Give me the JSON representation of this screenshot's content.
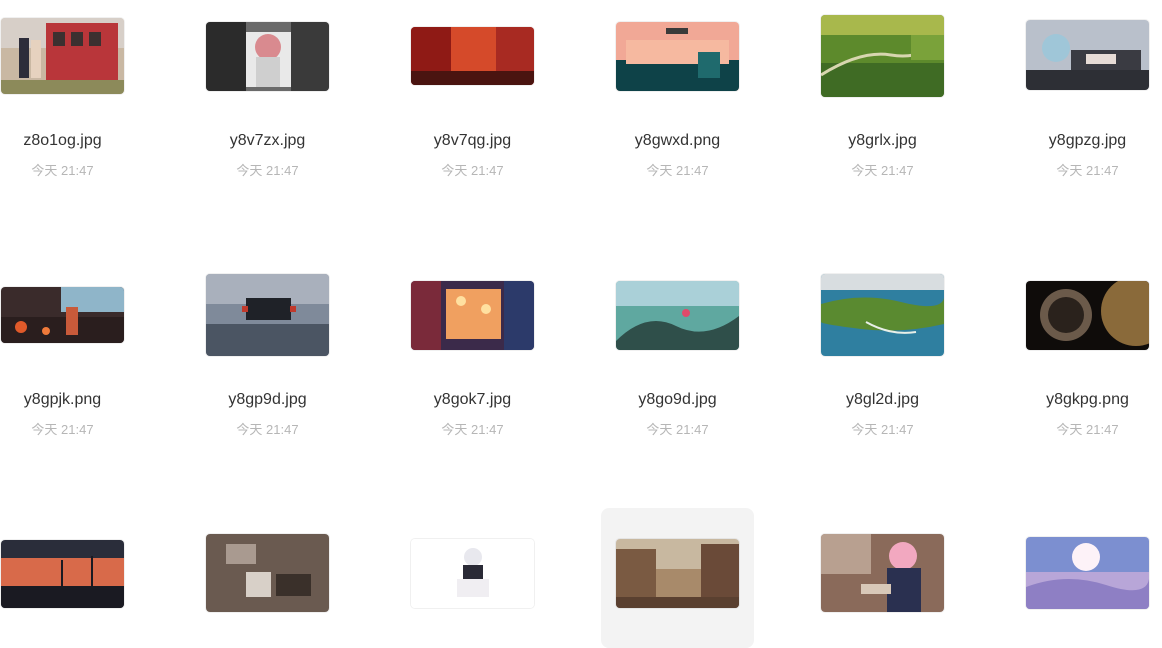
{
  "files": [
    {
      "name": "z8o1og.jpg",
      "date": "今天 21:47"
    },
    {
      "name": "y8v7zx.jpg",
      "date": "今天 21:47"
    },
    {
      "name": "y8v7qg.jpg",
      "date": "今天 21:47"
    },
    {
      "name": "y8gwxd.png",
      "date": "今天 21:47"
    },
    {
      "name": "y8grlx.jpg",
      "date": "今天 21:47"
    },
    {
      "name": "y8gpzg.jpg",
      "date": "今天 21:47"
    },
    {
      "name": "y8gpjk.png",
      "date": "今天 21:47"
    },
    {
      "name": "y8gp9d.jpg",
      "date": "今天 21:47"
    },
    {
      "name": "y8gok7.jpg",
      "date": "今天 21:47"
    },
    {
      "name": "y8go9d.jpg",
      "date": "今天 21:47"
    },
    {
      "name": "y8gl2d.jpg",
      "date": "今天 21:47"
    },
    {
      "name": "y8gkpg.png",
      "date": "今天 21:47"
    },
    {
      "name": "",
      "date": ""
    },
    {
      "name": "",
      "date": ""
    },
    {
      "name": "",
      "date": ""
    },
    {
      "name": "",
      "date": ""
    },
    {
      "name": "",
      "date": ""
    },
    {
      "name": "",
      "date": ""
    }
  ],
  "colors": {
    "background": "#ffffff",
    "hover_cell": "#f3f3f3",
    "filename_text": "#333333",
    "date_text": "#b6b6b6"
  }
}
